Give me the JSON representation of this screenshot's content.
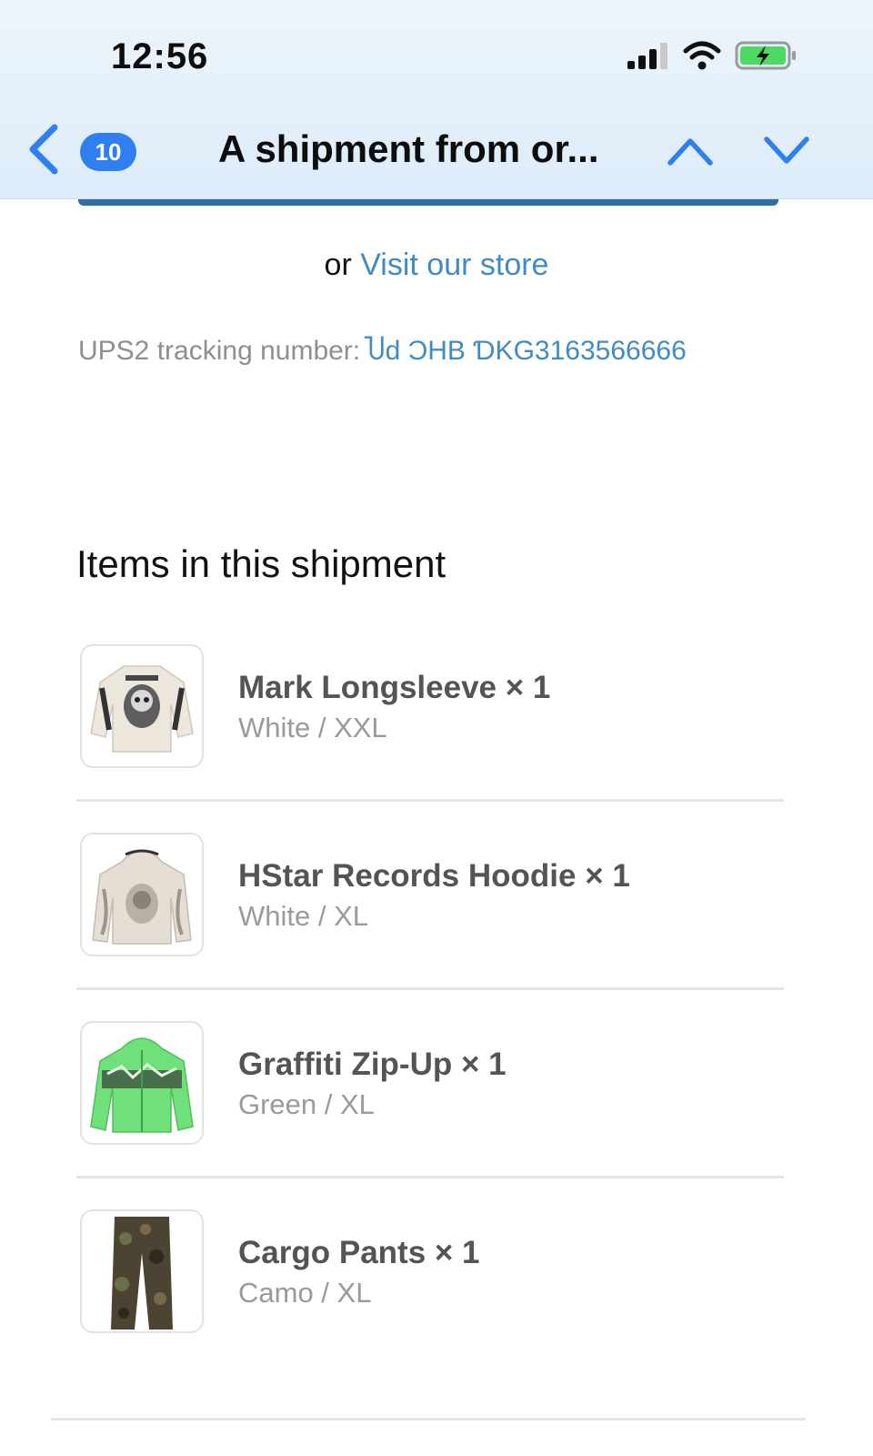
{
  "status_bar": {
    "time": "12:56"
  },
  "nav": {
    "badge_count": "10",
    "title": "A shipment from or..."
  },
  "body": {
    "visit_prefix": "or ",
    "visit_link": "Visit our store",
    "tracking_label": "UPS2 tracking number:",
    "tracking_value": "Ⴎd ƆHB ƊKG3163566666"
  },
  "items_heading": "Items in this shipment",
  "items": [
    {
      "name": "Mark Longsleeve × 1",
      "variant": "White / XXL"
    },
    {
      "name": "HStar Records Hoodie × 1",
      "variant": "White / XL"
    },
    {
      "name": "Graffiti Zip-Up × 1",
      "variant": "Green / XL"
    },
    {
      "name": "Cargo Pants × 1",
      "variant": "Camo / XL"
    }
  ],
  "colors": {
    "accent_blue": "#2f7ff0",
    "link_blue": "#3f8bc3",
    "cta_blue": "#2d6ea8",
    "battery_green": "#4cd964"
  },
  "icons": [
    "chevron-left-icon",
    "chevron-up-icon",
    "chevron-down-icon",
    "signal-icon",
    "wifi-icon",
    "battery-charging-icon"
  ]
}
